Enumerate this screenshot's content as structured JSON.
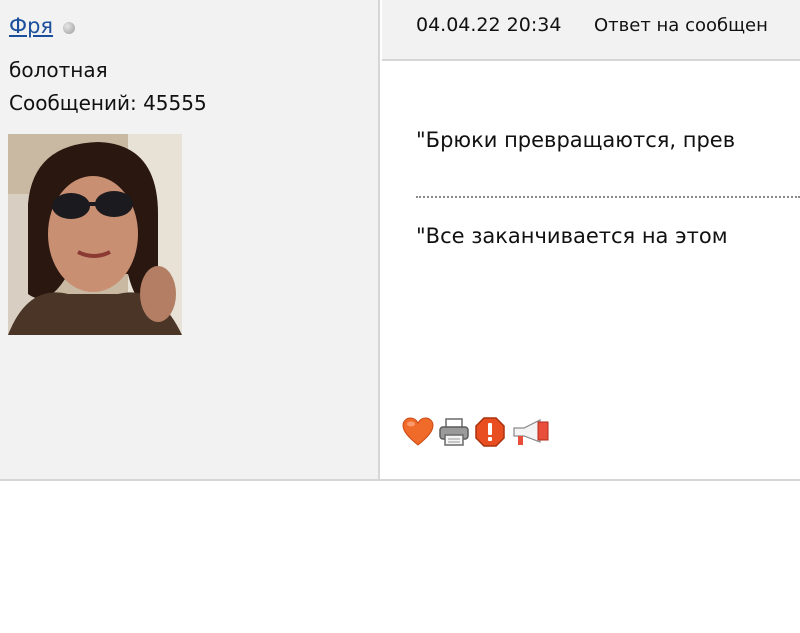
{
  "author": {
    "name": "Фря",
    "status": "болотная",
    "post_count": "Сообщений: 45555"
  },
  "post": {
    "date": "04.04.22 20:34",
    "title": "Ответ на сообщен",
    "text_line1": "\"Брюки превращаются, прев",
    "text_line2": "\"Все заканчивается на этом"
  },
  "icons": {
    "like": "heart-icon",
    "print": "printer-icon",
    "report": "warning-icon",
    "announce": "megaphone-icon"
  },
  "colors": {
    "link": "#1b4f9c",
    "sidebar_bg": "#f2f2f2",
    "border": "#d6d6d6"
  }
}
